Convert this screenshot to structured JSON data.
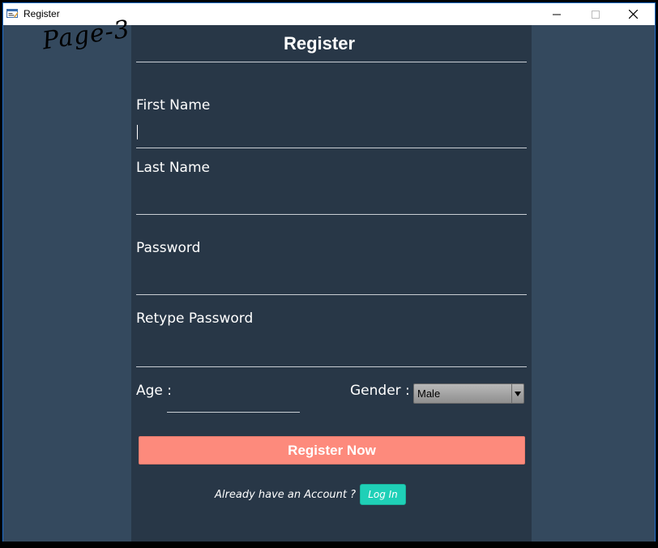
{
  "window": {
    "title": "Register",
    "controls": {
      "minimize": "—",
      "maximize": "☐",
      "close": "✕"
    }
  },
  "watermark": "Page-3",
  "form": {
    "title": "Register",
    "first_name": {
      "label": "First Name",
      "value": ""
    },
    "last_name": {
      "label": "Last Name",
      "value": ""
    },
    "password": {
      "label": "Password",
      "value": ""
    },
    "retype_password": {
      "label": "Retype Password",
      "value": ""
    },
    "age": {
      "label": "Age :",
      "value": ""
    },
    "gender": {
      "label": "Gender :",
      "selected": "Male"
    },
    "register_button": "Register Now",
    "already_text": "Already have an Account ?",
    "login_button": "Log In"
  },
  "colors": {
    "window_bg": "#34495e",
    "panel_bg": "#283747",
    "register_button": "#fd8a7c",
    "login_button": "#1fd0b7"
  }
}
